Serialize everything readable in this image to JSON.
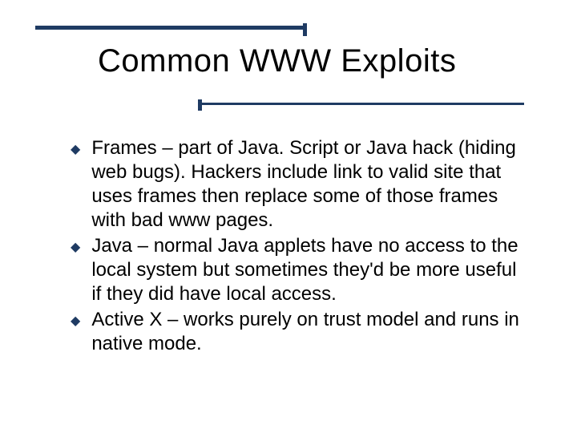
{
  "title": "Common WWW Exploits",
  "bullets": [
    {
      "text": "Frames – part of Java. Script or Java hack (hiding web bugs). Hackers include link to valid site that uses frames then replace some of those frames with bad www pages."
    },
    {
      "text": "Java – normal Java applets have no access to the local system but sometimes they'd be more useful if they did have local access."
    },
    {
      "text": "Active X – works purely on trust model and runs in native mode."
    }
  ],
  "colors": {
    "rule": "#1f3b63",
    "bullet": "#1f3b63",
    "text": "#000000",
    "background": "#ffffff"
  }
}
